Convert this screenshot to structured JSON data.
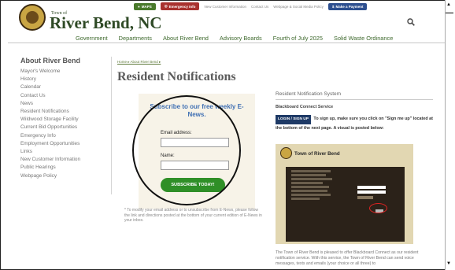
{
  "topbar": {
    "maps_label": "MAPS",
    "emergency_label": "Emergency Info",
    "new_customer_label": "New Customer Information",
    "contact_label": "Contact Us",
    "policy_label": "Webpage & Social Media Policy",
    "payment_label": "Make a Payment"
  },
  "header": {
    "town_of": "Town of",
    "site_name": "River Bend, NC"
  },
  "nav": {
    "items": [
      "Government",
      "Departments",
      "About River Bend",
      "Advisory Boards",
      "Fourth of July 2025",
      "Solid Waste Ordinance"
    ]
  },
  "sidebar": {
    "title": "About River Bend",
    "items": [
      "Mayor's Welcome",
      "History",
      "Calendar",
      "Contact Us",
      "News",
      "Resident Notifications",
      "Wildwood Storage Facility",
      "Current Bid Opportunities",
      "Emergency Info",
      "Employment Opportunities",
      "Links",
      "New Customer Information",
      "Public Hearings",
      "Webpage Policy"
    ]
  },
  "main": {
    "breadcrumb": "Home ▸ About River Bend ▸",
    "title": "Resident Notifications",
    "subscribe": {
      "title": "Subscribe to our free weekly E-News.",
      "email_label": "Email address:",
      "name_label": "Name:",
      "button": "SUBSCRIBE TODAY!"
    },
    "footnote": "* To modify your email address or to unsubscribe from E-News, please follow the link and directions posted at the bottom of your current edition of E-News in your inbox."
  },
  "right": {
    "heading": "Resident Notification System",
    "subheading": "Blackboard Connect Service",
    "login_button": "LOGIN / SIGN UP",
    "instruction": "To sign up, make sure you click on \"Sign me up\" located at the bottom of the next page. A visual is posted below:",
    "promo_title": "Town of River Bend",
    "bottom_text": "The Town of River Bend is pleased to offer Blackboard Connect as our resident notification service. With this service, the Town of River Bend can send voice messages, texts and emails (your choice or all three) to"
  },
  "colors": {
    "green": "#2f4a26",
    "accent_green": "#2f8f27",
    "blue": "#3f6fb3",
    "nav": "#3f6a2e"
  },
  "icons": {
    "search": "search-icon",
    "seal": "town-seal-icon",
    "location": "location-icon"
  }
}
